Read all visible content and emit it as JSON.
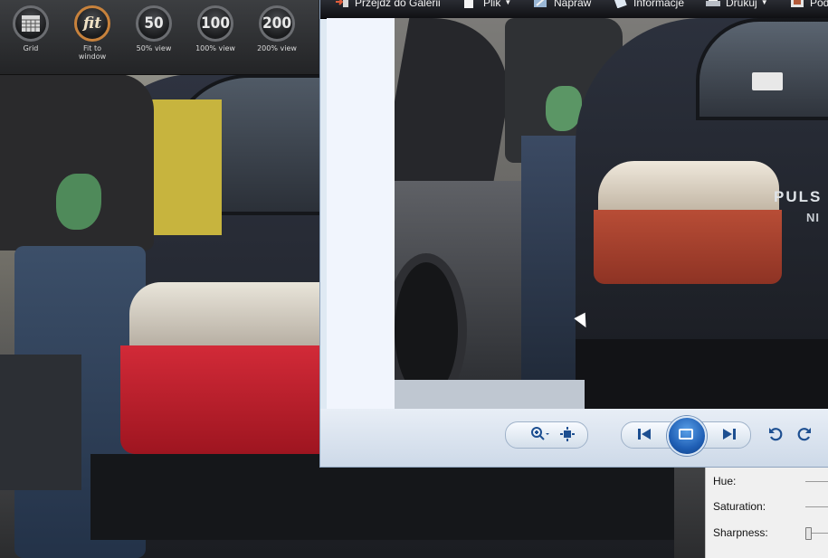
{
  "viewer_toolbar": {
    "buttons": [
      {
        "icon": "grid-icon",
        "glyph": "",
        "label": "Grid"
      },
      {
        "icon": "fit-icon",
        "glyph": "fit",
        "label": "Fit to\nwindow"
      },
      {
        "icon": "zoom-50-icon",
        "glyph": "50",
        "label": "50% view"
      },
      {
        "icon": "zoom-100-icon",
        "glyph": "100",
        "label": "100% view"
      },
      {
        "icon": "zoom-200-icon",
        "glyph": "200",
        "label": "200% view"
      }
    ],
    "active_color": "#c8823c"
  },
  "properties_panel": {
    "rows": [
      {
        "label": "Hue:"
      },
      {
        "label": "Saturation:"
      },
      {
        "label": "Sharpness:"
      }
    ]
  },
  "photo_gallery": {
    "menu": [
      {
        "label": "Przejdź do Galerii",
        "icon": "gallery-arrow-icon",
        "dropdown": false
      },
      {
        "label": "Plik",
        "icon": "file-icon",
        "dropdown": true
      },
      {
        "label": "Napraw",
        "icon": "fix-icon",
        "dropdown": false
      },
      {
        "label": "Informacje",
        "icon": "info-icon",
        "dropdown": false
      },
      {
        "label": "Drukuj",
        "icon": "print-icon",
        "dropdown": true
      },
      {
        "label": "Pod",
        "icon": "share-icon",
        "dropdown": false
      }
    ],
    "photo_text": {
      "badge": "PULS",
      "badge2": "NI"
    },
    "controls": {
      "zoom": "zoom-icon",
      "actual_size": "actual-size-icon",
      "previous": "previous-icon",
      "slideshow": "slideshow-icon",
      "next": "next-icon",
      "rotate_ccw": "rotate-ccw-icon",
      "rotate_cw": "rotate-cw-icon"
    },
    "accent": "#1f5fb5"
  }
}
